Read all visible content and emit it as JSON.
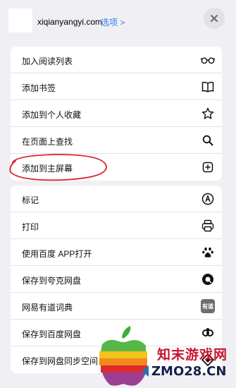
{
  "header": {
    "site_name": "xiqianyangyi.com",
    "options_label": "选项 >"
  },
  "group1": [
    {
      "label": "加入阅读列表",
      "icon": "reading-glasses-icon"
    },
    {
      "label": "添加书签",
      "icon": "open-book-icon"
    },
    {
      "label": "添加到个人收藏",
      "icon": "star-icon"
    },
    {
      "label": "在页面上查找",
      "icon": "search-icon"
    },
    {
      "label": "添加到主屏幕",
      "icon": "plus-square-icon"
    }
  ],
  "group2": [
    {
      "label": "标记",
      "icon": "markup-pen-icon"
    },
    {
      "label": "打印",
      "icon": "printer-icon"
    },
    {
      "label": "使用百度 APP打开",
      "icon": "baidu-paw-icon"
    },
    {
      "label": "保存到夸克网盘",
      "icon": "quark-icon"
    },
    {
      "label": "网易有道词典",
      "icon": "youdao-icon"
    },
    {
      "label": "保存到百度网盘",
      "icon": "baidu-netdisk-icon"
    },
    {
      "label": "保存到网盘同步空间",
      "icon": "sync-space-icon"
    }
  ],
  "youdao_icon_text": "有道",
  "watermark": {
    "line1": "知末游戏网",
    "line2": "ZMO28.CN"
  },
  "colors": {
    "accent": "#2f7cf6",
    "highlight_circle": "#d9232e",
    "background": "#efeff4"
  }
}
